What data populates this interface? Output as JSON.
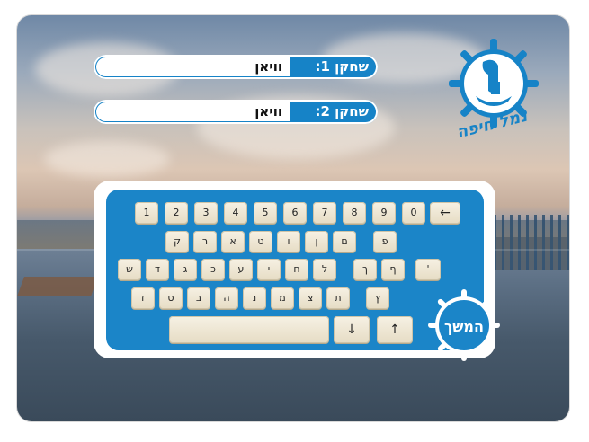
{
  "players": [
    {
      "label": "שחקן 1:",
      "value": "וויאן"
    },
    {
      "label": "שחקן 2:",
      "value": "וויאן"
    }
  ],
  "logo": {
    "text": "נמל חיפה",
    "icon": "ship-wheel-icon"
  },
  "keyboard": {
    "rows": [
      [
        "1",
        "2",
        "3",
        "4",
        "5",
        "6",
        "7",
        "8",
        "9",
        "0",
        "←"
      ],
      [
        "ק",
        "ר",
        "א",
        "ט",
        "ו",
        "ן",
        "ם",
        "פ"
      ],
      [
        "ש",
        "ד",
        "ג",
        "כ",
        "ע",
        "י",
        "ח",
        "ל",
        "ך",
        "ף",
        "'"
      ],
      [
        "ז",
        "ס",
        "ב",
        "ה",
        "נ",
        "מ",
        "צ",
        "ת",
        "ץ"
      ],
      [
        "",
        "↓",
        "↑"
      ]
    ]
  },
  "continue_button": {
    "label": "המשך"
  },
  "colors": {
    "accent": "#1683c7",
    "key": "#efe7d3",
    "panel": "#ffffff"
  }
}
